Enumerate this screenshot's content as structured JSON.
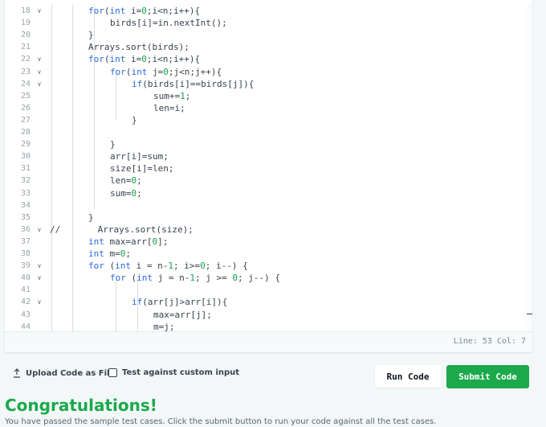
{
  "editor": {
    "lines": [
      {
        "n": "18",
        "fold": true,
        "code": [
          [
            "kw",
            "for"
          ],
          [
            "",
            "("
          ],
          [
            "kw",
            "int"
          ],
          [
            "",
            " i="
          ],
          [
            "num",
            "0"
          ],
          [
            "",
            ";i<n;i++){"
          ]
        ]
      },
      {
        "n": "19",
        "fold": false,
        "code": [
          [
            "",
            "birds[i]=in.nextInt();"
          ]
        ]
      },
      {
        "n": "20",
        "fold": false,
        "code": [
          [
            "",
            "}"
          ]
        ]
      },
      {
        "n": "21",
        "fold": false,
        "code": [
          [
            "",
            "Arrays.sort(birds);"
          ]
        ]
      },
      {
        "n": "22",
        "fold": true,
        "code": [
          [
            "kw",
            "for"
          ],
          [
            "",
            "("
          ],
          [
            "kw",
            "int"
          ],
          [
            "",
            " i="
          ],
          [
            "num",
            "0"
          ],
          [
            "",
            ";i<n;i++){"
          ]
        ]
      },
      {
        "n": "23",
        "fold": true,
        "code": [
          [
            "kw",
            "for"
          ],
          [
            "",
            "("
          ],
          [
            "kw",
            "int"
          ],
          [
            "",
            " j="
          ],
          [
            "num",
            "0"
          ],
          [
            "",
            ";j<n;j++){"
          ]
        ]
      },
      {
        "n": "24",
        "fold": true,
        "code": [
          [
            "kw",
            "if"
          ],
          [
            "",
            "(birds[i]==birds[j]){"
          ]
        ]
      },
      {
        "n": "25",
        "fold": false,
        "code": [
          [
            "",
            "sum+="
          ],
          [
            "num",
            "1"
          ],
          [
            "",
            ";"
          ]
        ]
      },
      {
        "n": "26",
        "fold": false,
        "code": [
          [
            "",
            "len=i;"
          ]
        ]
      },
      {
        "n": "27",
        "fold": false,
        "code": [
          [
            "",
            "}"
          ]
        ]
      },
      {
        "n": "28",
        "fold": false,
        "code": []
      },
      {
        "n": "29",
        "fold": false,
        "code": [
          [
            "",
            "}"
          ]
        ]
      },
      {
        "n": "30",
        "fold": false,
        "code": [
          [
            "",
            "arr[i]=sum;"
          ]
        ]
      },
      {
        "n": "31",
        "fold": false,
        "code": [
          [
            "",
            "size[i]=len;"
          ]
        ]
      },
      {
        "n": "32",
        "fold": false,
        "code": [
          [
            "",
            "len="
          ],
          [
            "num",
            "0"
          ],
          [
            "",
            ";"
          ]
        ]
      },
      {
        "n": "33",
        "fold": false,
        "code": [
          [
            "",
            "sum="
          ],
          [
            "num",
            "0"
          ],
          [
            "",
            ";"
          ]
        ]
      },
      {
        "n": "34",
        "fold": false,
        "code": []
      },
      {
        "n": "35",
        "fold": false,
        "code": [
          [
            "",
            "}"
          ]
        ]
      },
      {
        "n": "36",
        "fold": true,
        "code": [
          [
            "cm",
            "//       Arrays.sort(size);"
          ]
        ]
      },
      {
        "n": "37",
        "fold": false,
        "code": [
          [
            "kw",
            "int"
          ],
          [
            "",
            " max=arr["
          ],
          [
            "num",
            "0"
          ],
          [
            "",
            "];"
          ]
        ]
      },
      {
        "n": "38",
        "fold": false,
        "code": [
          [
            "kw",
            "int"
          ],
          [
            "",
            " m="
          ],
          [
            "num",
            "0"
          ],
          [
            "",
            ";"
          ]
        ]
      },
      {
        "n": "39",
        "fold": true,
        "code": [
          [
            "kw",
            "for"
          ],
          [
            "",
            " ("
          ],
          [
            "kw",
            "int"
          ],
          [
            "",
            " i = n-"
          ],
          [
            "num",
            "1"
          ],
          [
            "",
            "; i>="
          ],
          [
            "num",
            "0"
          ],
          [
            "",
            "; i--) {"
          ]
        ]
      },
      {
        "n": "40",
        "fold": true,
        "code": [
          [
            "kw",
            "for"
          ],
          [
            "",
            " ("
          ],
          [
            "kw",
            "int"
          ],
          [
            "",
            " j = n-"
          ],
          [
            "num",
            "1"
          ],
          [
            "",
            "; j >= "
          ],
          [
            "num",
            "0"
          ],
          [
            "",
            "; j--) {"
          ]
        ]
      },
      {
        "n": "41",
        "fold": false,
        "code": []
      },
      {
        "n": "42",
        "fold": true,
        "code": [
          [
            "kw",
            "if"
          ],
          [
            "",
            "(arr[j]>arr[i]){"
          ]
        ]
      },
      {
        "n": "43",
        "fold": false,
        "code": [
          [
            "",
            "max=arr[j];"
          ]
        ]
      },
      {
        "n": "44",
        "fold": false,
        "code": [
          [
            "",
            "m=j;"
          ]
        ]
      }
    ],
    "status": "Line: 53 Col: 7"
  },
  "actions": {
    "upload_label": "Upload Code as File",
    "custom_input_label": "Test against custom input",
    "run_label": "Run Code",
    "submit_label": "Submit Code"
  },
  "result": {
    "title": "Congratulations!",
    "message": "You have passed the sample test cases. Click the submit button to run your code against all the test cases."
  },
  "colors": {
    "accent": "#1ba94c",
    "keyword": "#2b6ad8",
    "number": "#16a34a",
    "text": "#39424e"
  },
  "icons": {
    "upload": "upload-icon",
    "fold": "chevron-down-icon"
  }
}
